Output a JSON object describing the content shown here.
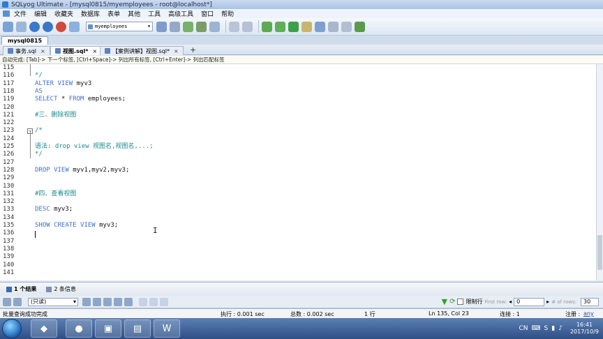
{
  "window": {
    "title": "SQLyog Ultimate - [mysql0815/myemployees - root@localhost*]"
  },
  "menu": {
    "items": [
      "文件",
      "编辑",
      "收藏夹",
      "数据库",
      "表单",
      "其他",
      "工具",
      "高级工具",
      "窗口",
      "帮助"
    ]
  },
  "toolbar": {
    "database": "myemployees"
  },
  "connection_tab": "mysql0815",
  "query_tabs": [
    {
      "label": "事务.sql",
      "active": false
    },
    {
      "label": "视图.sql*",
      "active": true
    },
    {
      "label": "【案例讲解】视图.sql*",
      "active": false
    }
  ],
  "hint": "自动完成: [Tab]-> 下一个标签, [Ctrl+Space]-> 列出所有标签, [Ctrl+Enter]-> 列出匹配标签",
  "editor": {
    "lines": [
      {
        "n": "115",
        "parts": []
      },
      {
        "n": "116",
        "parts": [
          {
            "t": "*/",
            "c": "cm"
          }
        ]
      },
      {
        "n": "117",
        "parts": [
          {
            "t": "ALTER VIEW ",
            "c": "kw"
          },
          {
            "t": "myv3",
            "c": "tx"
          }
        ]
      },
      {
        "n": "118",
        "parts": [
          {
            "t": "AS",
            "c": "kw"
          }
        ]
      },
      {
        "n": "119",
        "parts": [
          {
            "t": "SELECT ",
            "c": "kw"
          },
          {
            "t": "* ",
            "c": "tx"
          },
          {
            "t": "FROM ",
            "c": "kw"
          },
          {
            "t": "employees;",
            "c": "tx"
          }
        ]
      },
      {
        "n": "120",
        "parts": []
      },
      {
        "n": "121",
        "parts": [
          {
            "t": "#三、删除视图",
            "c": "cm"
          }
        ]
      },
      {
        "n": "122",
        "parts": []
      },
      {
        "n": "123",
        "parts": [
          {
            "t": "/*",
            "c": "cm"
          }
        ]
      },
      {
        "n": "124",
        "parts": []
      },
      {
        "n": "125",
        "parts": [
          {
            "t": "语法: drop view 视图名,视图名,...;",
            "c": "cm"
          }
        ]
      },
      {
        "n": "126",
        "parts": [
          {
            "t": "*/",
            "c": "cm"
          }
        ]
      },
      {
        "n": "127",
        "parts": []
      },
      {
        "n": "128",
        "parts": [
          {
            "t": "DROP VIEW ",
            "c": "kw"
          },
          {
            "t": "myv1,myv2,myv3;",
            "c": "tx"
          }
        ]
      },
      {
        "n": "129",
        "parts": []
      },
      {
        "n": "130",
        "parts": []
      },
      {
        "n": "131",
        "parts": [
          {
            "t": "#四、查看视图",
            "c": "cm"
          }
        ]
      },
      {
        "n": "132",
        "parts": []
      },
      {
        "n": "133",
        "parts": [
          {
            "t": "DESC ",
            "c": "kw"
          },
          {
            "t": "myv3;",
            "c": "tx"
          }
        ]
      },
      {
        "n": "134",
        "parts": []
      },
      {
        "n": "135",
        "parts": [
          {
            "t": "SHOW CREATE VIEW ",
            "c": "kw"
          },
          {
            "t": "myv3;",
            "c": "tx"
          }
        ]
      },
      {
        "n": "136",
        "parts": []
      },
      {
        "n": "137",
        "parts": []
      },
      {
        "n": "138",
        "parts": []
      },
      {
        "n": "139",
        "parts": []
      },
      {
        "n": "140",
        "parts": []
      },
      {
        "n": "141",
        "parts": []
      }
    ]
  },
  "results": {
    "tabs": [
      {
        "label": "1 个结果",
        "active": true
      },
      {
        "label": "2 条信息",
        "active": false
      }
    ],
    "mode": "(只读)",
    "limit_label": "限制行",
    "first_row_hint": "First row:",
    "first_row": "0",
    "rows_hint": "# of rows:",
    "rows": "30"
  },
  "status": {
    "left": "批量查询成功完成",
    "exec": "执行 : 0.001 sec",
    "total": "总数 : 0.002 sec",
    "rows": "1 行",
    "position": "Ln 135, Col 23",
    "connections": "连接 : 1",
    "register_label": "注册 :",
    "register_user": "any"
  },
  "taskbar": {
    "tray_lang": "CN",
    "time": "16:41",
    "date": "2017/10/9"
  }
}
